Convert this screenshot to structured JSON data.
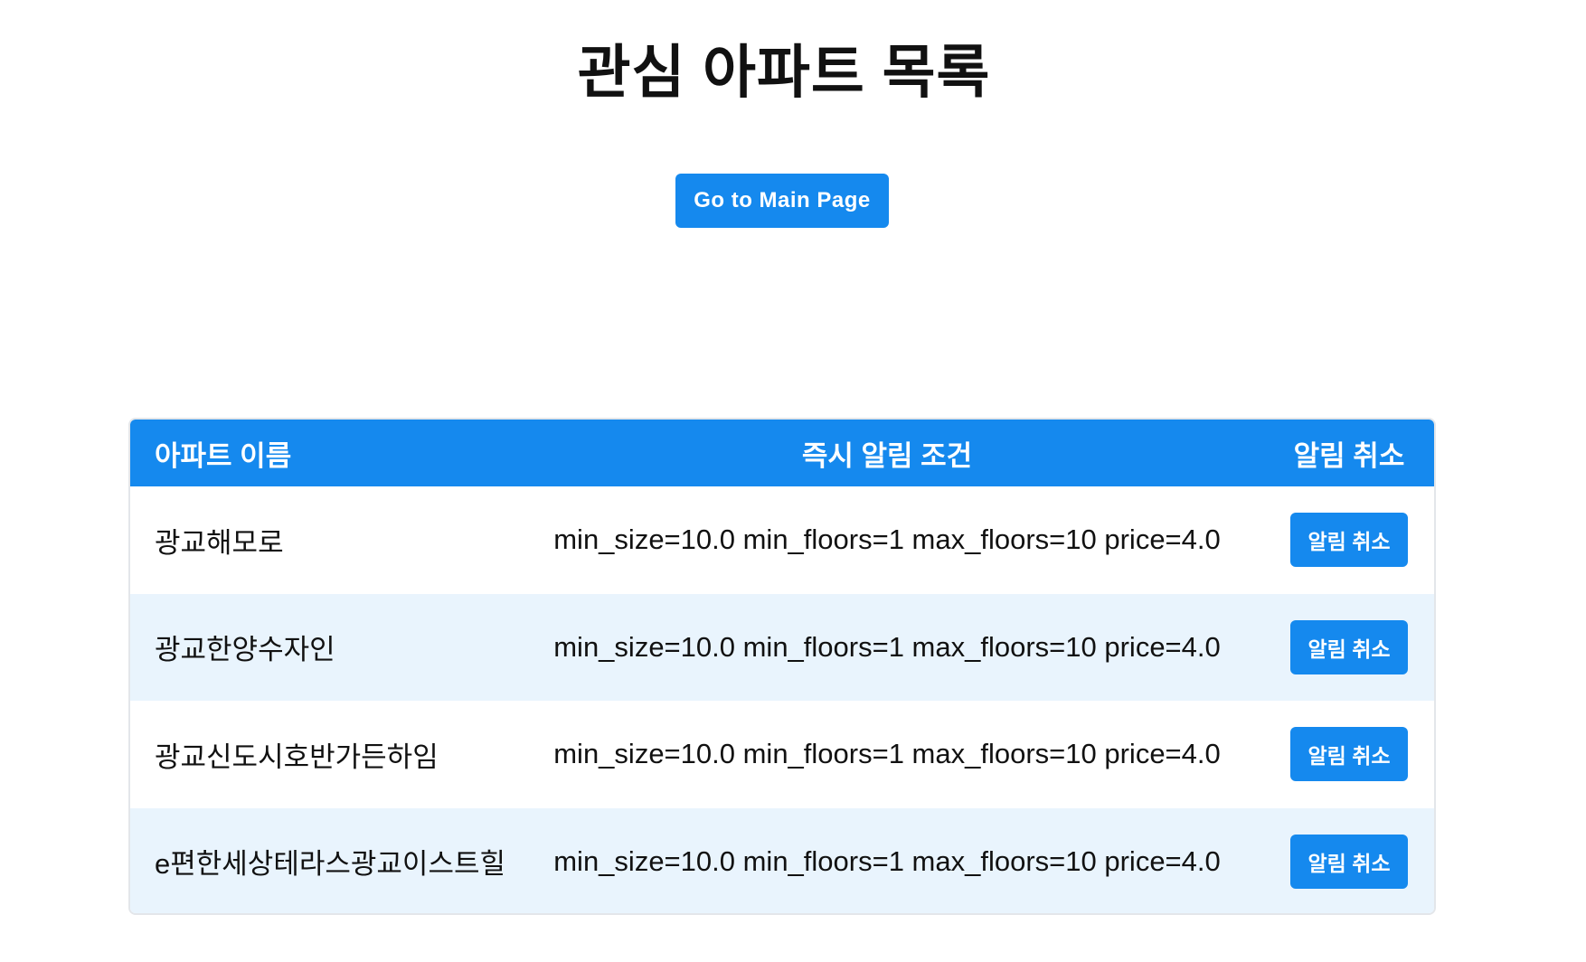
{
  "header": {
    "title": "관심 아파트 목록",
    "main_button_label": "Go to Main Page"
  },
  "table": {
    "columns": {
      "name": "아파트 이름",
      "condition": "즉시 알림 조건",
      "cancel": "알림 취소"
    },
    "rows": [
      {
        "name": "광교해모로",
        "condition": "min_size=10.0 min_floors=1 max_floors=10 price=4.0",
        "cancel_label": "알림 취소"
      },
      {
        "name": "광교한양수자인",
        "condition": "min_size=10.0 min_floors=1 max_floors=10 price=4.0",
        "cancel_label": "알림 취소"
      },
      {
        "name": "광교신도시호반가든하임",
        "condition": "min_size=10.0 min_floors=1 max_floors=10 price=4.0",
        "cancel_label": "알림 취소"
      },
      {
        "name": "e편한세상테라스광교이스트힐",
        "condition": "min_size=10.0 min_floors=1 max_floors=10 price=4.0",
        "cancel_label": "알림 취소"
      }
    ]
  },
  "colors": {
    "accent": "#1589ee",
    "row_alt": "#e9f4fd",
    "border": "#e3e6ea"
  }
}
